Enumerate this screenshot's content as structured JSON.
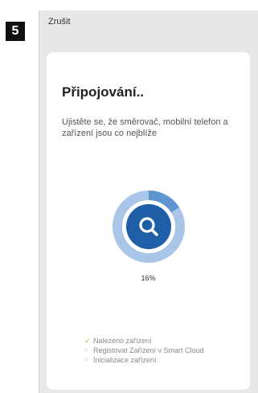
{
  "step_badge": "5",
  "topbar": {
    "cancel_label": "Zrušit"
  },
  "card": {
    "title": "Připojování..",
    "subtitle": "Ujistěte se, že směrovač, mobilní telefon a zařízení jsou co nejblíže",
    "progress": {
      "value": 16,
      "label": "16%",
      "icon": "search-icon"
    },
    "steps": [
      {
        "label": "Nalezeno zařízení",
        "state": "done",
        "icon": "check-icon"
      },
      {
        "label": "Registovat Zařízení v Smart Cloud",
        "state": "pending",
        "icon": "dot-icon"
      },
      {
        "label": "Inicializace zařízení",
        "state": "pending",
        "icon": "dot-icon"
      }
    ]
  },
  "colors": {
    "ring_track": "#a9c6e8",
    "ring_progress": "#5f96d1",
    "center": "#1f5fa8",
    "check": "#7bbf3a"
  }
}
